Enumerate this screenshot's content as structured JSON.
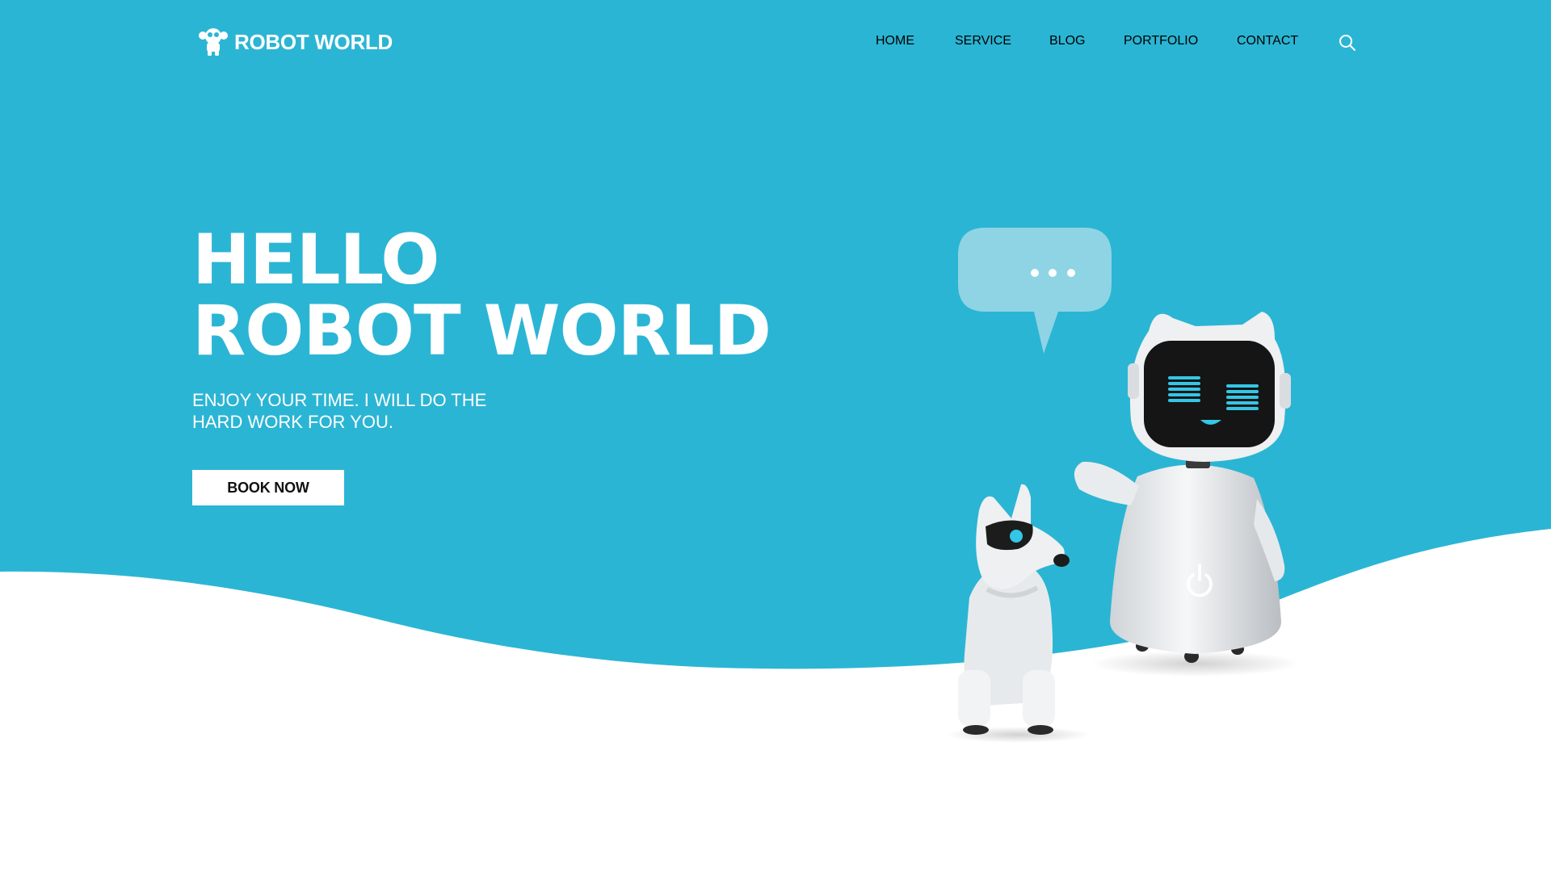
{
  "colors": {
    "brand": "#2BB5D4",
    "surface": "#FFFFFF",
    "bubble": "#8FD4E4",
    "screen_glow": "#34C6E6"
  },
  "header": {
    "logo_icon": "robot-logo-icon",
    "logo_text": "ROBOT WORLD",
    "nav": [
      {
        "label": "HOME"
      },
      {
        "label": "SERVICE"
      },
      {
        "label": "BLOG"
      },
      {
        "label": "PORTFOLIO"
      },
      {
        "label": "CONTACT"
      }
    ],
    "search_icon": "search-icon"
  },
  "hero": {
    "title_line1": "HELLO",
    "title_line2": "ROBOT WORLD",
    "subtitle_line1": "ENJOY YOUR TIME. I WILL DO THE",
    "subtitle_line2": "HARD WORK FOR YOU.",
    "cta_label": "BOOK NOW"
  }
}
